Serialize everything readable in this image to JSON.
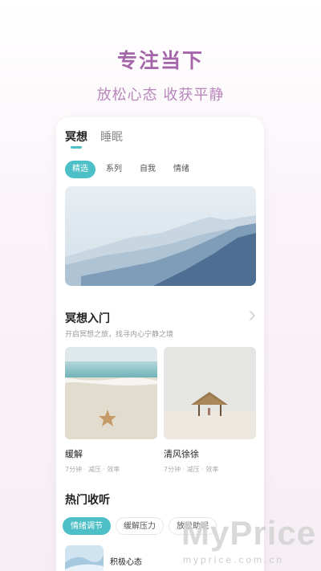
{
  "hero": {
    "title": "专注当下",
    "subtitle": "放松心态 收获平静"
  },
  "tabs": [
    {
      "label": "冥想",
      "active": true
    },
    {
      "label": "睡眠",
      "active": false
    }
  ],
  "chips": [
    {
      "label": "精选",
      "active": true
    },
    {
      "label": "系列",
      "active": false
    },
    {
      "label": "自我",
      "active": false
    },
    {
      "label": "情绪",
      "active": false
    }
  ],
  "intro": {
    "title": "冥想入门",
    "subtitle": "开启冥想之旅，找寻内心宁静之境",
    "more_icon": "chevron-right-icon"
  },
  "tiles": [
    {
      "title": "缓解",
      "meta": "7分钟 · 减压 · 效率"
    },
    {
      "title": "清风徐徐",
      "meta": "7分钟 · 减压 · 效率"
    }
  ],
  "popular": {
    "title": "热门收听",
    "filters": [
      {
        "label": "情绪调节",
        "active": true
      },
      {
        "label": "缓解压力",
        "active": false
      },
      {
        "label": "放松助眠",
        "active": false
      }
    ],
    "items": [
      {
        "title": "积极心态"
      }
    ]
  },
  "watermark": {
    "text": "MyPrice",
    "url": "myprice.com.cn"
  },
  "colors": {
    "accent": "#4dbfc6",
    "brand": "#a565a9"
  }
}
